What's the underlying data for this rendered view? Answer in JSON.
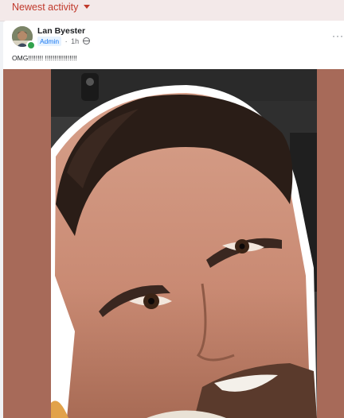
{
  "feed": {
    "sort_label": "Newest activity"
  },
  "post": {
    "author": "Lan Byester",
    "role_badge": "Admin",
    "time": "1h",
    "separator": "·",
    "more_glyph": "···",
    "text": "OMG!!!!!!!! !!!!!!!!!!!!!!!!!",
    "media_background": "#a76a59"
  },
  "colors": {
    "accent": "#c0392b",
    "online": "#31a24c",
    "badge_text": "#1877f2"
  }
}
